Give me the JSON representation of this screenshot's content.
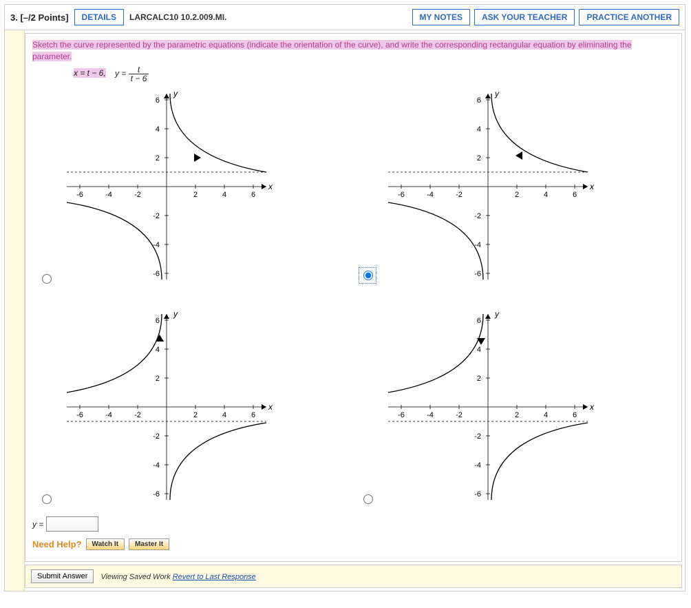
{
  "header": {
    "qnum": "3. [–/2 Points]",
    "details": "DETAILS",
    "source": "LARCALC10 10.2.009.MI.",
    "mynotes": "MY NOTES",
    "askteacher": "ASK YOUR TEACHER",
    "practice": "PRACTICE ANOTHER"
  },
  "prompt": {
    "line1": "Sketch the curve represented by the parametric equations (indicate the orientation of the curve), and write the corresponding rectangular equation by eliminating the",
    "line2": "parameter.",
    "eq_x": "x = t − 6,",
    "eq_y_prefix": "y =",
    "frac_num": "t",
    "frac_den": "t − 6"
  },
  "axes": {
    "ylabel": "y",
    "xlabel": "x",
    "ticks_x": [
      -6,
      -4,
      -2,
      2,
      4,
      6
    ],
    "ticks_y": [
      6,
      4,
      2,
      -2,
      -4,
      -6
    ]
  },
  "options": {
    "selected": 1,
    "arrows": [
      "right",
      "left",
      "right",
      "left"
    ]
  },
  "answer": {
    "label": "y =",
    "value": ""
  },
  "help": {
    "label": "Need Help?",
    "watch": "Watch It",
    "master": "Master It"
  },
  "footer": {
    "submit": "Submit Answer",
    "viewing": "Viewing Saved Work ",
    "revert": "Revert to Last Response"
  }
}
